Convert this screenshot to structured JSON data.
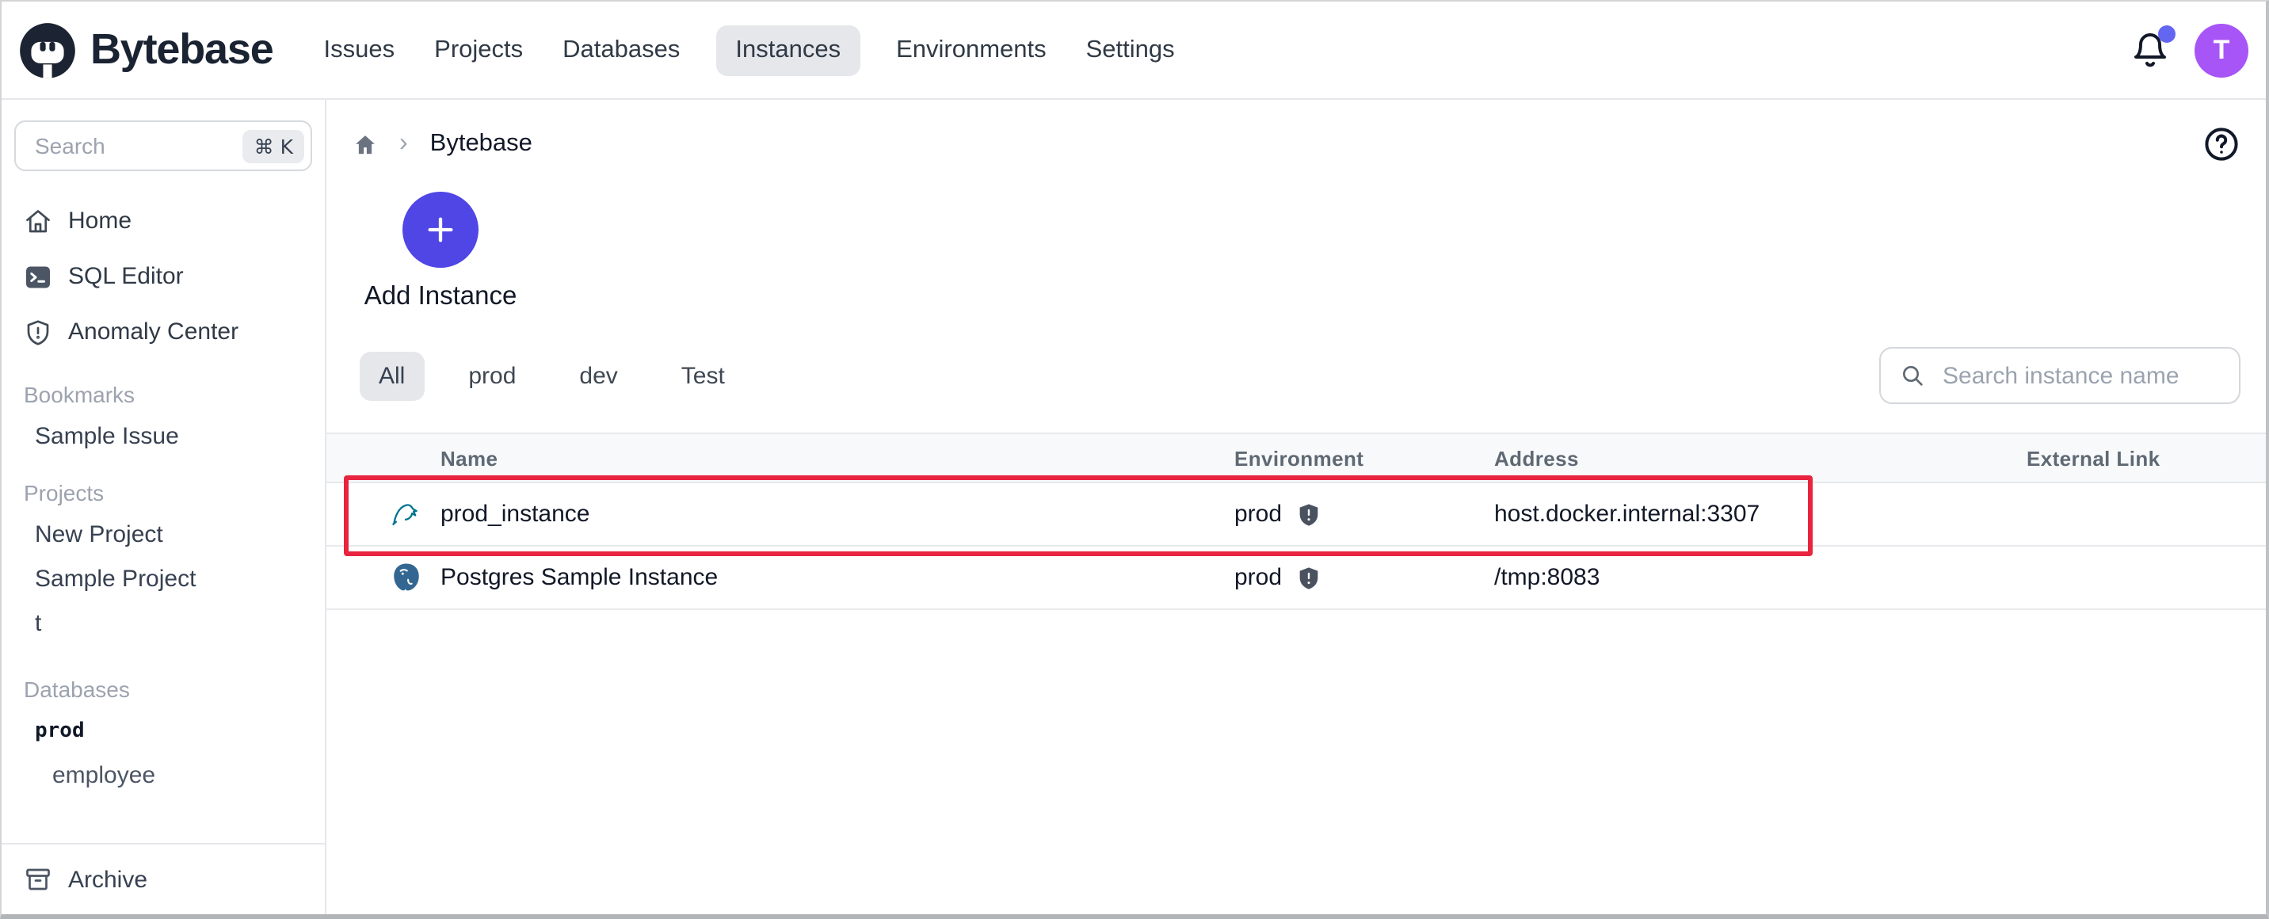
{
  "header": {
    "logo_text": "Bytebase",
    "nav_items": [
      {
        "label": "Issues",
        "active": false
      },
      {
        "label": "Projects",
        "active": false
      },
      {
        "label": "Databases",
        "active": false
      },
      {
        "label": "Instances",
        "active": true
      },
      {
        "label": "Environments",
        "active": false
      },
      {
        "label": "Settings",
        "active": false
      }
    ],
    "notifications": {
      "icon": "bell-icon",
      "unread_dot": true
    },
    "avatar_initial": "T"
  },
  "sidebar": {
    "search": {
      "placeholder": "Search",
      "shortcut": "⌘ K"
    },
    "nav_items": [
      {
        "label": "Home",
        "icon": "home-icon"
      },
      {
        "label": "SQL Editor",
        "icon": "terminal-icon"
      },
      {
        "label": "Anomaly Center",
        "icon": "shield-alert-icon"
      }
    ],
    "sections": [
      {
        "title": "Bookmarks",
        "items": [
          {
            "label": "Sample Issue"
          }
        ]
      },
      {
        "title": "Projects",
        "items": [
          {
            "label": "New Project"
          },
          {
            "label": "Sample Project"
          },
          {
            "label": "t"
          }
        ]
      },
      {
        "title": "Databases",
        "items": [
          {
            "label": "prod"
          },
          {
            "label": "employee"
          }
        ]
      }
    ],
    "archive": {
      "label": "Archive",
      "icon": "archive-icon"
    }
  },
  "breadcrumb": {
    "home_icon": "home-icon",
    "current": "Bytebase"
  },
  "main": {
    "add_instance": {
      "label": "Add Instance",
      "icon": "plus-icon"
    },
    "env_tabs": [
      {
        "label": "All",
        "active": true
      },
      {
        "label": "prod",
        "active": false
      },
      {
        "label": "dev",
        "active": false
      },
      {
        "label": "Test",
        "active": false
      }
    ],
    "search": {
      "placeholder": "Search instance name",
      "icon": "search-icon"
    },
    "table": {
      "columns": [
        "Name",
        "Environment",
        "Address",
        "External Link"
      ],
      "rows": [
        {
          "engine_icon": "mysql-icon",
          "name": "prod_instance",
          "environment": "prod",
          "env_icon": "shield-icon",
          "address": "host.docker.internal:3307",
          "external_link": "",
          "highlighted": true
        },
        {
          "engine_icon": "postgres-icon",
          "name": "Postgres Sample Instance",
          "environment": "prod",
          "env_icon": "shield-icon",
          "address": "/tmp:8083",
          "external_link": "",
          "highlighted": false
        }
      ]
    }
  },
  "colors": {
    "brand_indigo": "#4f46e5",
    "avatar_purple": "#a855f7",
    "notification_dot": "#6366f1",
    "highlight_red": "#e8243f",
    "active_tab_bg": "#e5e7eb"
  }
}
